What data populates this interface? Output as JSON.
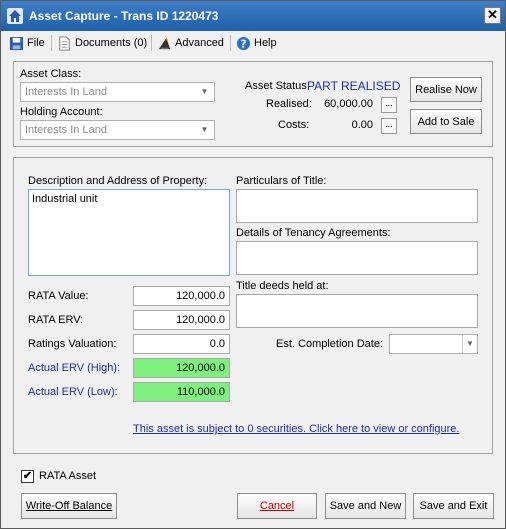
{
  "window": {
    "title": "Asset Capture - Trans ID 1220473",
    "close_glyph": "✕"
  },
  "menu": {
    "file": "File",
    "documents": "Documents (0)",
    "advanced": "Advanced",
    "help": "Help"
  },
  "top_panel": {
    "asset_class_label": "Asset Class:",
    "asset_class_value": "Interests In Land",
    "holding_account_label": "Holding Account:",
    "holding_account_value": "Interests In Land",
    "asset_status_label": "Asset Status",
    "asset_status_value": "PART REALISED",
    "realised_label": "Realised:",
    "realised_value": "60,000.00",
    "costs_label": "Costs:",
    "costs_value": "0.00",
    "ellipsis": "...",
    "realise_now": "Realise Now",
    "add_to_sale": "Add to Sale"
  },
  "property": {
    "description_label": "Description and Address of Property:",
    "description_value": "Industrial unit",
    "rata_value_label": "RATA Value:",
    "rata_value": "120,000.0",
    "rata_erv_label": "RATA ERV:",
    "rata_erv": "120,000.0",
    "ratings_valuation_label": "Ratings Valuation:",
    "ratings_valuation": "0.0",
    "actual_erv_high_label": "Actual ERV (High):",
    "actual_erv_high": "120,000.0",
    "actual_erv_low_label": "Actual ERV (Low):",
    "actual_erv_low": "110,000.0",
    "particulars_label": "Particulars of Title:",
    "tenancy_label": "Details of Tenancy Agreements:",
    "title_deeds_label": "Title deeds held at:",
    "est_completion_label": "Est. Completion Date:",
    "securities_link": "This asset is subject to 0 securities.  Click here to view or configure."
  },
  "footer": {
    "rata_asset_label": "RATA Asset",
    "rata_asset_checked": true,
    "check_glyph": "✔",
    "write_off": "Write-Off Balance",
    "cancel": "Cancel",
    "save_and_new": "Save and New",
    "save_and_exit": "Save and Exit"
  },
  "colors": {
    "title_bar": "#2a6cb8",
    "green_field": "#7ef07e",
    "link_blue": "#1f2f9a",
    "cancel_red": "#c00000"
  }
}
